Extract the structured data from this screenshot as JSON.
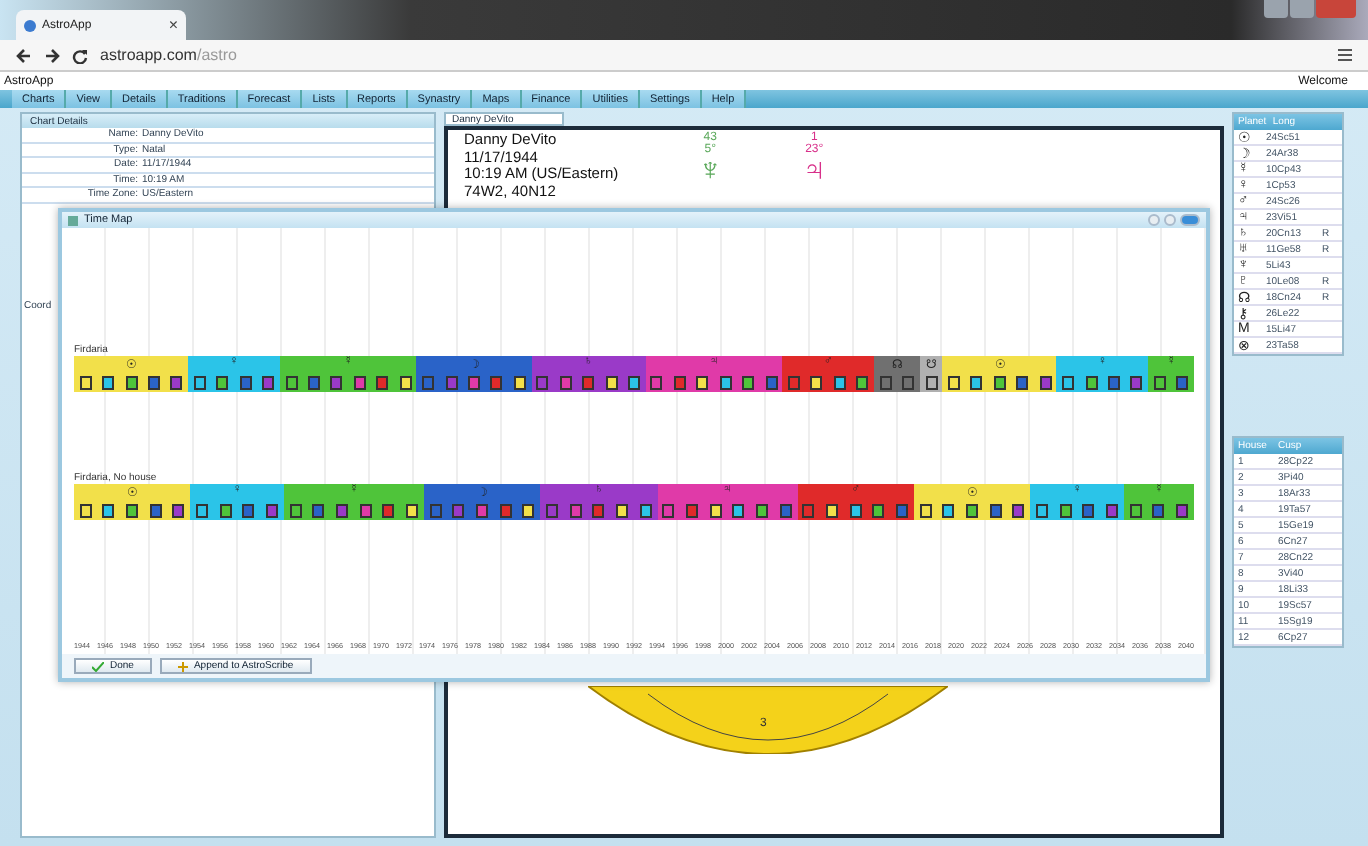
{
  "browser": {
    "tab_title": "AstroApp",
    "tab_close": "×",
    "url_host": "astroapp.com",
    "url_path": "/astro"
  },
  "app": {
    "title": "AstroApp",
    "welcome": "Welcome"
  },
  "menu": [
    {
      "label": "Charts",
      "selected": false
    },
    {
      "label": "View",
      "selected": false
    },
    {
      "label": "Details",
      "selected": false
    },
    {
      "label": "Traditions",
      "selected": false
    },
    {
      "label": "Forecast",
      "selected": false
    },
    {
      "label": "Lists",
      "selected": false
    },
    {
      "label": "Reports",
      "selected": false
    },
    {
      "label": "Synastry",
      "selected": false
    },
    {
      "label": "Maps",
      "selected": false
    },
    {
      "label": "Finance",
      "selected": false
    },
    {
      "label": "Utilities",
      "selected": false
    },
    {
      "label": "Settings",
      "selected": false
    },
    {
      "label": "Help",
      "selected": false
    }
  ],
  "chart_details": {
    "title": "Chart Details",
    "rows": [
      {
        "label": "Name:",
        "value": "Danny DeVito"
      },
      {
        "label": "Type:",
        "value": "Natal"
      },
      {
        "label": "Date:",
        "value": "11/17/1944"
      },
      {
        "label": "Time:",
        "value": "10:19 AM"
      },
      {
        "label": "Time Zone:",
        "value": "US/Eastern"
      }
    ],
    "side_label": "Coord"
  },
  "chart": {
    "tab": "Danny DeVito",
    "lines": [
      "Danny DeVito",
      "11/17/1944",
      "10:19 AM (US/Eastern)",
      "74W2, 40N12"
    ],
    "glyphs": [
      {
        "glyph": "♆",
        "degree": "5°",
        "number": "43",
        "color": "#5aa85a"
      },
      {
        "glyph": "♃",
        "degree": "23°",
        "number": "1",
        "color": "#d8308a"
      }
    ],
    "wheel_label": "3"
  },
  "planets": {
    "columns": [
      "Planet",
      "Long"
    ],
    "rows": [
      {
        "glyph": "☉",
        "long": "24Sc51",
        "retro": ""
      },
      {
        "glyph": "☽",
        "long": "24Ar38",
        "retro": ""
      },
      {
        "glyph": "☿",
        "long": "10Cp43",
        "retro": ""
      },
      {
        "glyph": "♀",
        "long": "1Cp53",
        "retro": ""
      },
      {
        "glyph": "♂",
        "long": "24Sc26",
        "retro": ""
      },
      {
        "glyph": "♃",
        "long": "23Vi51",
        "retro": ""
      },
      {
        "glyph": "♄",
        "long": "20Cn13",
        "retro": "R"
      },
      {
        "glyph": "♅",
        "long": "11Ge58",
        "retro": "R"
      },
      {
        "glyph": "♆",
        "long": "5Li43",
        "retro": ""
      },
      {
        "glyph": "♇",
        "long": "10Le08",
        "retro": "R"
      },
      {
        "glyph": "☊",
        "long": "18Cn24",
        "retro": "R"
      },
      {
        "glyph": "⚷",
        "long": "26Le22",
        "retro": ""
      },
      {
        "glyph": "M",
        "long": "15Li47",
        "retro": ""
      },
      {
        "glyph": "⊗",
        "long": "23Ta58",
        "retro": ""
      }
    ]
  },
  "houses": {
    "columns": [
      "House",
      "Cusp"
    ],
    "rows": [
      {
        "number": "1",
        "cusp": "28Cp22"
      },
      {
        "number": "2",
        "cusp": "3Pi40"
      },
      {
        "number": "3",
        "cusp": "18Ar33"
      },
      {
        "number": "4",
        "cusp": "19Ta57"
      },
      {
        "number": "5",
        "cusp": "15Ge19"
      },
      {
        "number": "6",
        "cusp": "6Cn27"
      },
      {
        "number": "7",
        "cusp": "28Cn22"
      },
      {
        "number": "8",
        "cusp": "3Vi40"
      },
      {
        "number": "9",
        "cusp": "18Li33"
      },
      {
        "number": "10",
        "cusp": "19Sc57"
      },
      {
        "number": "11",
        "cusp": "15Sg19"
      },
      {
        "number": "12",
        "cusp": "6Cp27"
      }
    ]
  },
  "time_map": {
    "title": "Time Map",
    "rows": [
      {
        "label": "Firdaria",
        "periods": [
          {
            "glyph": "☉",
            "color": "#f2e04a",
            "subperiods": [
              {
                "color": "#f2e04a"
              },
              {
                "color": "#2bc4e8"
              },
              {
                "color": "#4fc43a"
              },
              {
                "color": "#2a63c8"
              },
              {
                "color": "#9a3ac8"
              }
            ]
          },
          {
            "glyph": "♀",
            "color": "#2bc4e8",
            "subperiods": [
              {
                "color": "#2bc4e8"
              },
              {
                "color": "#4fc43a"
              },
              {
                "color": "#2a63c8"
              },
              {
                "color": "#9a3ac8"
              }
            ]
          },
          {
            "glyph": "☿",
            "color": "#4fc43a",
            "subperiods": [
              {
                "color": "#4fc43a"
              },
              {
                "color": "#2a63c8"
              },
              {
                "color": "#9a3ac8"
              },
              {
                "color": "#e03aa8"
              },
              {
                "color": "#e02a2a"
              },
              {
                "color": "#f2e04a"
              }
            ]
          },
          {
            "glyph": "☽",
            "color": "#2a63c8",
            "subperiods": [
              {
                "color": "#2a63c8"
              },
              {
                "color": "#9a3ac8"
              },
              {
                "color": "#e03aa8"
              },
              {
                "color": "#e02a2a"
              },
              {
                "color": "#f2e04a"
              }
            ]
          },
          {
            "glyph": "♄",
            "color": "#9a3ac8",
            "subperiods": [
              {
                "color": "#9a3ac8"
              },
              {
                "color": "#e03aa8"
              },
              {
                "color": "#e02a2a"
              },
              {
                "color": "#f2e04a"
              },
              {
                "color": "#2bc4e8"
              }
            ]
          },
          {
            "glyph": "♃",
            "color": "#e03aa8",
            "subperiods": [
              {
                "color": "#e03aa8"
              },
              {
                "color": "#e02a2a"
              },
              {
                "color": "#f2e04a"
              },
              {
                "color": "#2bc4e8"
              },
              {
                "color": "#4fc43a"
              },
              {
                "color": "#2a63c8"
              }
            ]
          },
          {
            "glyph": "♂",
            "color": "#e02a2a",
            "subperiods": [
              {
                "color": "#e02a2a"
              },
              {
                "color": "#f2e04a"
              },
              {
                "color": "#2bc4e8"
              },
              {
                "color": "#4fc43a"
              }
            ]
          },
          {
            "glyph": "☊",
            "color": "#707070",
            "subperiods": [
              {
                "color": "#707070"
              },
              {
                "color": "#707070"
              }
            ]
          },
          {
            "glyph": "☋",
            "color": "#b0b0b0",
            "subperiods": [
              {
                "color": "#b0b0b0"
              }
            ]
          },
          {
            "glyph": "☉",
            "color": "#f2e04a",
            "subperiods": [
              {
                "color": "#f2e04a"
              },
              {
                "color": "#2bc4e8"
              },
              {
                "color": "#4fc43a"
              },
              {
                "color": "#2a63c8"
              },
              {
                "color": "#9a3ac8"
              }
            ]
          },
          {
            "glyph": "♀",
            "color": "#2bc4e8",
            "subperiods": [
              {
                "color": "#2bc4e8"
              },
              {
                "color": "#4fc43a"
              },
              {
                "color": "#2a63c8"
              },
              {
                "color": "#9a3ac8"
              }
            ]
          },
          {
            "glyph": "☿",
            "color": "#4fc43a",
            "subperiods": [
              {
                "color": "#4fc43a"
              },
              {
                "color": "#2a63c8"
              }
            ]
          }
        ]
      },
      {
        "label": "Firdaria, No house",
        "periods": [
          {
            "glyph": "☉",
            "color": "#f2e04a",
            "subperiods": [
              {
                "color": "#f2e04a"
              },
              {
                "color": "#2bc4e8"
              },
              {
                "color": "#4fc43a"
              },
              {
                "color": "#2a63c8"
              },
              {
                "color": "#9a3ac8"
              }
            ]
          },
          {
            "glyph": "♀",
            "color": "#2bc4e8",
            "subperiods": [
              {
                "color": "#2bc4e8"
              },
              {
                "color": "#4fc43a"
              },
              {
                "color": "#2a63c8"
              },
              {
                "color": "#9a3ac8"
              }
            ]
          },
          {
            "glyph": "☿",
            "color": "#4fc43a",
            "subperiods": [
              {
                "color": "#4fc43a"
              },
              {
                "color": "#2a63c8"
              },
              {
                "color": "#9a3ac8"
              },
              {
                "color": "#e03aa8"
              },
              {
                "color": "#e02a2a"
              },
              {
                "color": "#f2e04a"
              }
            ]
          },
          {
            "glyph": "☽",
            "color": "#2a63c8",
            "subperiods": [
              {
                "color": "#2a63c8"
              },
              {
                "color": "#9a3ac8"
              },
              {
                "color": "#e03aa8"
              },
              {
                "color": "#e02a2a"
              },
              {
                "color": "#f2e04a"
              }
            ]
          },
          {
            "glyph": "♄",
            "color": "#9a3ac8",
            "subperiods": [
              {
                "color": "#9a3ac8"
              },
              {
                "color": "#e03aa8"
              },
              {
                "color": "#e02a2a"
              },
              {
                "color": "#f2e04a"
              },
              {
                "color": "#2bc4e8"
              }
            ]
          },
          {
            "glyph": "♃",
            "color": "#e03aa8",
            "subperiods": [
              {
                "color": "#e03aa8"
              },
              {
                "color": "#e02a2a"
              },
              {
                "color": "#f2e04a"
              },
              {
                "color": "#2bc4e8"
              },
              {
                "color": "#4fc43a"
              },
              {
                "color": "#2a63c8"
              }
            ]
          },
          {
            "glyph": "♂",
            "color": "#e02a2a",
            "subperiods": [
              {
                "color": "#e02a2a"
              },
              {
                "color": "#f2e04a"
              },
              {
                "color": "#2bc4e8"
              },
              {
                "color": "#4fc43a"
              },
              {
                "color": "#2a63c8"
              }
            ]
          },
          {
            "glyph": "☉",
            "color": "#f2e04a",
            "subperiods": [
              {
                "color": "#f2e04a"
              },
              {
                "color": "#2bc4e8"
              },
              {
                "color": "#4fc43a"
              },
              {
                "color": "#2a63c8"
              },
              {
                "color": "#9a3ac8"
              }
            ]
          },
          {
            "glyph": "♀",
            "color": "#2bc4e8",
            "subperiods": [
              {
                "color": "#2bc4e8"
              },
              {
                "color": "#4fc43a"
              },
              {
                "color": "#2a63c8"
              },
              {
                "color": "#9a3ac8"
              }
            ]
          },
          {
            "glyph": "☿",
            "color": "#4fc43a",
            "subperiods": [
              {
                "color": "#4fc43a"
              },
              {
                "color": "#2a63c8"
              },
              {
                "color": "#9a3ac8"
              }
            ]
          }
        ]
      }
    ],
    "years": [
      "1944",
      "1946",
      "1948",
      "1950",
      "1952",
      "1954",
      "1956",
      "1958",
      "1960",
      "1962",
      "1964",
      "1966",
      "1968",
      "1970",
      "1972",
      "1974",
      "1976",
      "1978",
      "1980",
      "1982",
      "1984",
      "1986",
      "1988",
      "1990",
      "1992",
      "1994",
      "1996",
      "1998",
      "2000",
      "2002",
      "2004",
      "2006",
      "2008",
      "2010",
      "2012",
      "2014",
      "2016",
      "2018",
      "2020",
      "2022",
      "2024",
      "2026",
      "2028",
      "2030",
      "2032",
      "2034",
      "2036",
      "2038",
      "2040"
    ],
    "buttons": [
      "Done",
      "Append to AstroScribe"
    ]
  }
}
